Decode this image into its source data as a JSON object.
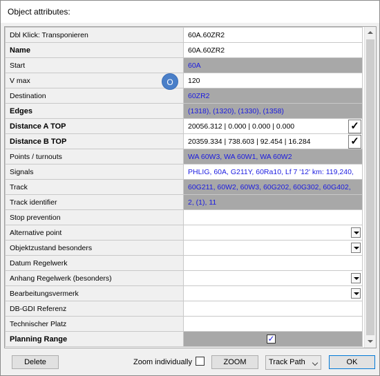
{
  "window": {
    "title": "Object attributes:"
  },
  "rows": [
    {
      "label": "Dbl Klick: Transponieren",
      "value": "60A.60ZR2",
      "bold": false,
      "style": "white",
      "control": "none"
    },
    {
      "label": "Name",
      "value": "60A.60ZR2",
      "bold": true,
      "style": "white",
      "control": "none"
    },
    {
      "label": "Start",
      "value": "60A",
      "bold": false,
      "style": "gray",
      "control": "none"
    },
    {
      "label": "V max",
      "value": "120",
      "bold": false,
      "style": "white",
      "control": "none"
    },
    {
      "label": "Destination",
      "value": "60ZR2",
      "bold": false,
      "style": "gray",
      "control": "none"
    },
    {
      "label": "Edges",
      "value": "(1318), (1320), (1330), (1358)",
      "bold": true,
      "style": "gray",
      "control": "none"
    },
    {
      "label": "Distance A TOP",
      "value": "20056.312 | 0.000 | 0.000 | 0.000",
      "bold": true,
      "style": "white",
      "control": "check"
    },
    {
      "label": "Distance B TOP",
      "value": "20359.334 | 738.603 | 92.454 | 16.284",
      "bold": true,
      "style": "white",
      "control": "check"
    },
    {
      "label": "Points / turnouts",
      "value": "WA 60W3, WA 60W1, WA 60W2",
      "bold": false,
      "style": "gray",
      "control": "none"
    },
    {
      "label": "Signals",
      "value": "PHLIG, 60A, G211Y, 60Ra10, Lf 7 '12' km: 119,240,",
      "bold": false,
      "style": "blue",
      "control": "none"
    },
    {
      "label": "Track",
      "value": "60G211, 60W2, 60W3, 60G202, 60G302, 60G402,",
      "bold": false,
      "style": "gray",
      "control": "none"
    },
    {
      "label": "Track identifier",
      "value": "2, (1), 11",
      "bold": false,
      "style": "gray",
      "control": "none"
    },
    {
      "label": "Stop prevention",
      "value": "",
      "bold": false,
      "style": "white",
      "control": "none"
    },
    {
      "label": "Alternative point",
      "value": "",
      "bold": false,
      "style": "white",
      "control": "dropdown"
    },
    {
      "label": "Objektzustand besonders",
      "value": "",
      "bold": false,
      "style": "white",
      "control": "dropdown"
    },
    {
      "label": "Datum Regelwerk",
      "value": "",
      "bold": false,
      "style": "white",
      "control": "none"
    },
    {
      "label": "Anhang Regelwerk (besonders)",
      "value": "",
      "bold": false,
      "style": "white",
      "control": "dropdown"
    },
    {
      "label": "Bearbeitungsvermerk",
      "value": "",
      "bold": false,
      "style": "white",
      "control": "dropdown"
    },
    {
      "label": "DB-GDI Referenz",
      "value": "",
      "bold": false,
      "style": "white",
      "control": "none"
    },
    {
      "label": "Technischer Platz",
      "value": "",
      "bold": false,
      "style": "white",
      "control": "none"
    },
    {
      "label": "Planning Range",
      "value": "",
      "bold": true,
      "style": "gray",
      "control": "checkbox",
      "checked": true
    }
  ],
  "check_glyph": "✓",
  "checkbox_glyph": "✓",
  "badge": {
    "text": "O",
    "color": "#4a7fc8"
  },
  "footer": {
    "delete_label": "Delete",
    "zoom_individually_label": "Zoom individually",
    "zoom_individually_checked": false,
    "zoom_label": "ZOOM",
    "track_path_value": "Track Path",
    "ok_label": "OK"
  },
  "colors": {
    "gray_row": "#a8a8a8",
    "link_text": "#1a1ae0"
  }
}
